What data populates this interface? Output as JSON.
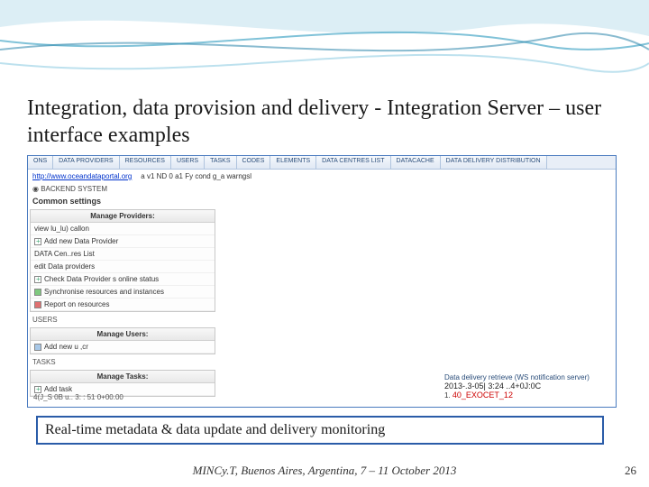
{
  "title": "Integration, data provision and delivery - Integration Server – user interface examples",
  "ui": {
    "tabs": [
      "ONS",
      "DATA PROVIDERS",
      "RESOURCES",
      "USERS",
      "TASKS",
      "CODES",
      "ELEMENTS",
      "DATA CENTRES LIST",
      "DATACACHE",
      "DATA DELIVERY DISTRIBUTION"
    ],
    "url": "http://www.oceandataportal.org",
    "url_suffix": "a v1 ND 0 a1 Fy cond g_a warngsl",
    "backend": "◉ BACKEND SYSTEM",
    "common": "Common settings",
    "providers": {
      "head": "Manage Providers:",
      "items": [
        "view lu_lu) callon",
        "Add new Data Provider",
        "DATA Cen..res List",
        "edit Data providers",
        "Check Data Provider s online status",
        "Synchronise resources and instances",
        "Report on resources"
      ]
    },
    "users": {
      "sec": "USERS",
      "head": "Manage Users:",
      "items": [
        "Add new u ,cr"
      ]
    },
    "tasks": {
      "sec": "TASKS",
      "head": "Manage Tasks:",
      "items": [
        "Add task"
      ]
    },
    "ts_left": "4(J_S 0B u.. 3: : 51 0+00.00",
    "right": {
      "hdr": "Data delivery retrieve (WS notification server)",
      "ts": "2013-.3-05| 3:24 ..4+0J:0C",
      "num": "1.",
      "cruise": "40_EXOCET_12"
    }
  },
  "caption": "Real-time metadata & data update and delivery monitoring",
  "footer": "MINCy.T, Buenos Aires, Argentina, 7 – 11 October 2013",
  "page": "26"
}
